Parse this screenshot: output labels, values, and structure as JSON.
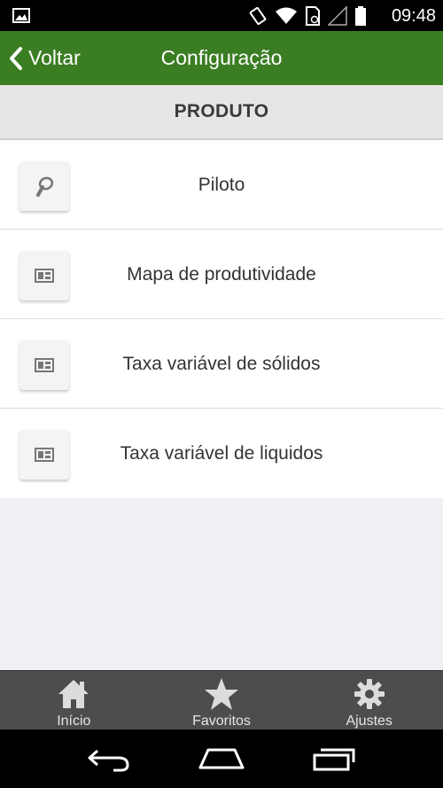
{
  "status_bar": {
    "time": "09:48",
    "icons": [
      "image-icon",
      "rotate-icon",
      "wifi-icon",
      "sim-icon",
      "signal-icon",
      "battery-icon"
    ]
  },
  "nav_bar": {
    "back_label": "Voltar",
    "title": "Configuração",
    "background_color": "#3b7d23"
  },
  "section": {
    "header": "PRODUTO"
  },
  "items": [
    {
      "label": "Piloto",
      "icon": "steering-icon"
    },
    {
      "label": "Mapa de produtividade",
      "icon": "map-icon"
    },
    {
      "label": "Taxa variável de sólidos",
      "icon": "map-icon"
    },
    {
      "label": "Taxa variável de liquidos",
      "icon": "map-icon"
    }
  ],
  "tab_bar": {
    "tabs": [
      {
        "label": "Início",
        "icon": "home-icon"
      },
      {
        "label": "Favoritos",
        "icon": "star-icon"
      },
      {
        "label": "Ajustes",
        "icon": "gear-icon"
      }
    ]
  },
  "system_nav": {
    "buttons": [
      "back-icon",
      "home-icon",
      "recent-apps-icon"
    ]
  }
}
